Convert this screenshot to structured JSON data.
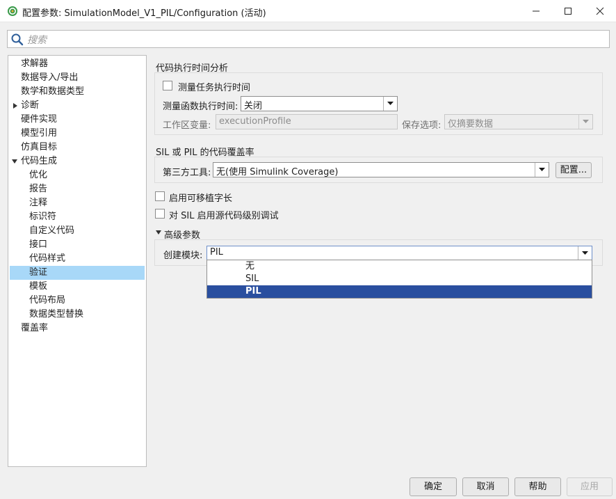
{
  "window": {
    "title": "配置参数: SimulationModel_V1_PIL/Configuration (活动)"
  },
  "search": {
    "placeholder": "搜索"
  },
  "tree": {
    "items": [
      {
        "label": "求解器"
      },
      {
        "label": "数据导入/导出"
      },
      {
        "label": "数学和数据类型"
      },
      {
        "label": "诊断",
        "expander": "collapsed"
      },
      {
        "label": "硬件实现"
      },
      {
        "label": "模型引用"
      },
      {
        "label": "仿真目标"
      },
      {
        "label": "代码生成",
        "expander": "expanded"
      },
      {
        "label": "优化"
      },
      {
        "label": "报告"
      },
      {
        "label": "注释"
      },
      {
        "label": "标识符"
      },
      {
        "label": "自定义代码"
      },
      {
        "label": "接口"
      },
      {
        "label": "代码样式"
      },
      {
        "label": "验证",
        "selected": true
      },
      {
        "label": "模板"
      },
      {
        "label": "代码布局"
      },
      {
        "label": "数据类型替换"
      },
      {
        "label": "覆盖率"
      }
    ]
  },
  "profiling": {
    "section_title": "代码执行时间分析",
    "measure_task_label": "测量任务执行时间",
    "measure_func_label": "测量函数执行时间:",
    "measure_func_value": "关闭",
    "workspace_var_label": "工作区变量:",
    "workspace_var_value": "executionProfile",
    "save_option_label": "保存选项:",
    "save_option_value": "仅摘要数据"
  },
  "coverage": {
    "section_title": "SIL 或 PIL 的代码覆盖率",
    "third_party_label": "第三方工具:",
    "third_party_value": "无(使用 Simulink Coverage)",
    "configure_button": "配置..."
  },
  "options": {
    "portable_word_sizes": "启用可移植字长",
    "source_level_debug": "对 SIL 启用源代码级别调试"
  },
  "advanced": {
    "section_title": "高级参数",
    "create_block_label": "创建模块:",
    "create_block_value": "PIL",
    "dropdown_options": [
      "无",
      "SIL",
      "PIL"
    ],
    "dropdown_highlighted": "PIL"
  },
  "buttons": {
    "ok": "确定",
    "cancel": "取消",
    "help": "帮助",
    "apply": "应用"
  },
  "colors": {
    "selection_tree": "#a8d8f8",
    "selection_list": "#2a4f9f"
  }
}
